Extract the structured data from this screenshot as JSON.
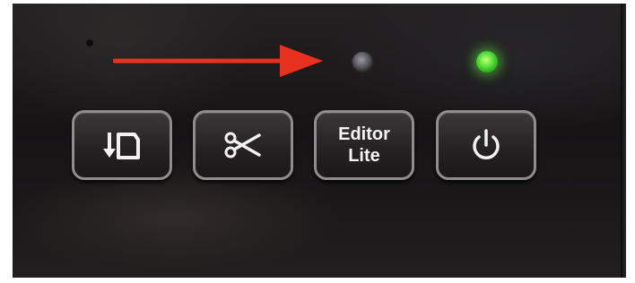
{
  "buttons": {
    "feed": {
      "icon": "feed-paper-icon"
    },
    "cut": {
      "icon": "scissors-icon"
    },
    "editor": {
      "line1": "Editor",
      "line2": "Lite"
    },
    "power": {
      "icon": "power-icon"
    }
  },
  "indicators": {
    "status_led": {
      "state": "off",
      "color": "#6b6b70"
    },
    "power_led": {
      "state": "on",
      "color": "#57e03b"
    }
  },
  "annotation": {
    "arrow_color": "#e8321e",
    "points_to": "status-led"
  }
}
